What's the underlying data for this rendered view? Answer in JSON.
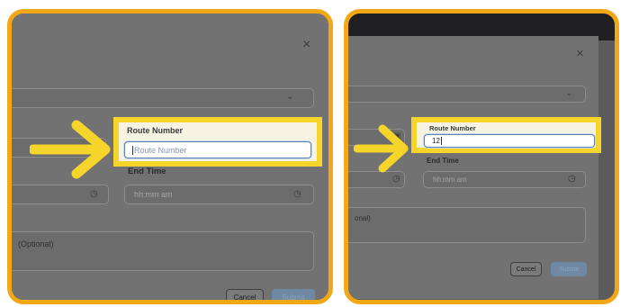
{
  "steps": [
    {
      "route_number_label": "Route Number",
      "route_number_placeholder": "Route Number",
      "route_number_value": "",
      "end_time_label": "End Time",
      "time_placeholder": "hh:mm am",
      "notes_placeholder": "(Optional)",
      "cancel_label": "Cancel",
      "submit_label": "Submit",
      "close_glyph": "×",
      "dropdown_glyph": "⌄",
      "clock_glyph": "◷",
      "calendar_glyph": "▣"
    },
    {
      "route_number_label": "Route Number",
      "route_number_value": "12",
      "end_time_label": "End Time",
      "time_placeholder": "hh:mm am",
      "notes_placeholder": "onal)",
      "cancel_label": "Cancel",
      "submit_label": "Submit",
      "close_glyph": "×",
      "dropdown_glyph": "⌄",
      "clock_glyph": "◷",
      "calendar_glyph": "▣"
    }
  ],
  "colors": {
    "highlight_border": "#f5d52a",
    "frame_border": "#f2a816",
    "arrow": "#f5d52a",
    "overlay": "#5b5b5b"
  },
  "icons": [
    "close-icon",
    "chevron-down-icon",
    "calendar-icon",
    "clock-icon",
    "arrow-icon"
  ]
}
